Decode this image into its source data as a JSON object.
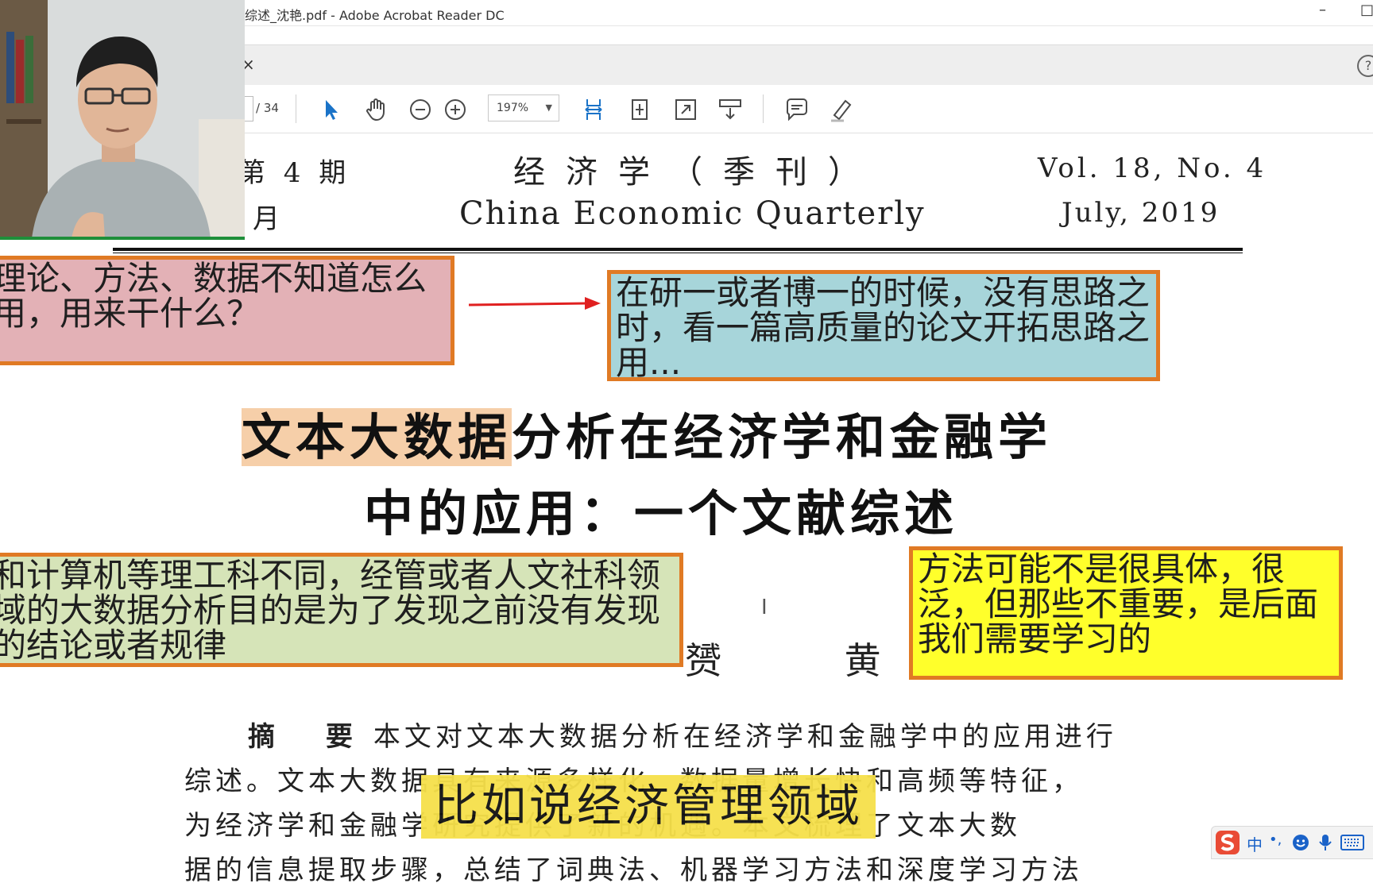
{
  "window": {
    "title": "综述_沈艳.pdf - Adobe Acrobat Reader DC",
    "minimize_glyph": "–",
    "restore_glyph": "□"
  },
  "tabbar": {
    "close_glyph": "×",
    "help_glyph": "?"
  },
  "toolbar": {
    "page_total": "/ 34",
    "zoom_value": "197%",
    "icons": [
      "select-arrow",
      "hand-pan",
      "zoom-out",
      "zoom-in",
      "fit-width",
      "fit-page",
      "full-screen",
      "scroll-mode",
      "comment",
      "highlight-pen"
    ]
  },
  "document": {
    "header": {
      "issue": "第 4 期",
      "month": "月",
      "journal_cn": "经济学（季刊）",
      "journal_en": "China Economic Quarterly",
      "volume": "Vol. 18, No. 4",
      "date": "July, 2019"
    },
    "title_line1_highlight": "文本大数据",
    "title_line1_rest": "分析在经济学和金融学",
    "title_line2": "中的应用：一个文献综述",
    "authors": "赟 黄 卓",
    "abstract_label": "摘 要",
    "abstract_lines": [
      "本文对文本大数据分析在经济学和金融学中的应用进行",
      "综述。文本大数据具有来源多样化、数据量增长快和高频等特征，",
      "为经济学和金融学研究提供了新的机遇。本文梳理了文本大数",
      "据的信息提取步骤，总结了词典法、机器学习方法和深度学习方法"
    ]
  },
  "annotations": {
    "pink": "理论、方法、数据不知道怎么用，用来干什么？",
    "blue": "在研一或者博一的时候，没有思路之时，看一篇高质量的论文开拓思路之用...",
    "green": "和计算机等理工科不同，经管或者人文社科领域的大数据分析目的是为了发现之前没有发现的结论或者规律",
    "yellow": "方法可能不是很具体，很泛，但那些不重要，是后面我们需要学习的"
  },
  "subtitle": "比如说经济管理领域",
  "ime": {
    "label": "中",
    "punct": "•,"
  },
  "colors": {
    "toolbar_icon": "#4a4a4a",
    "active_icon": "#1a73c8",
    "annotation_border": "#e07a24",
    "arrow": "#e02020",
    "title_highlight": "#f6cfa9",
    "subtitle_bg": "#f6e04a"
  }
}
